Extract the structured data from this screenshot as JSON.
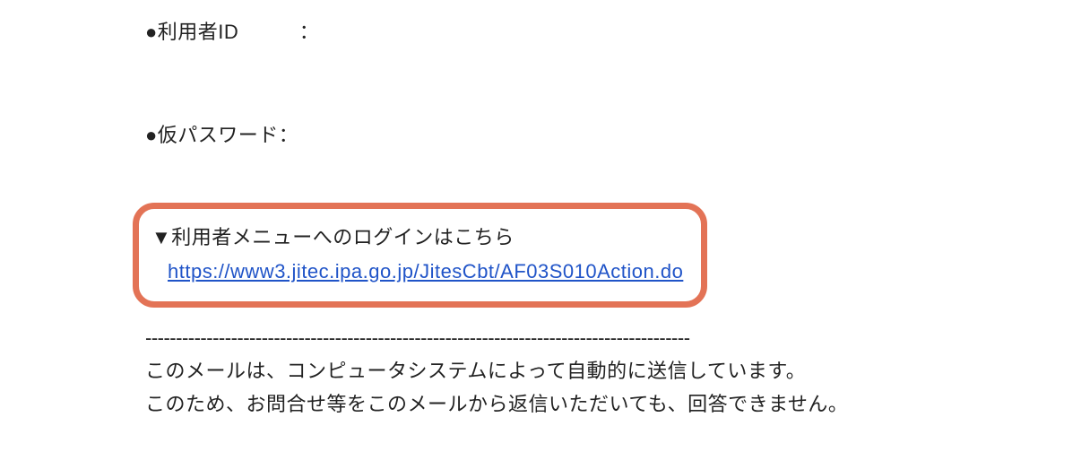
{
  "fields": {
    "user_id_label": "●利用者ID　　　：",
    "temp_password_label": "●仮パスワード："
  },
  "login_section": {
    "heading": "▼利用者メニューへのログインはこちら",
    "url_text": "https://www3.jitec.ipa.go.jp/JitesCbt/AF03S010Action.do"
  },
  "divider": "-----------------------------------------------------------------------------------------",
  "notes": {
    "line1": "このメールは、コンピュータシステムによって自動的に送信しています。",
    "line2": "このため、お問合せ等をこのメールから返信いただいても、回答できません。"
  }
}
